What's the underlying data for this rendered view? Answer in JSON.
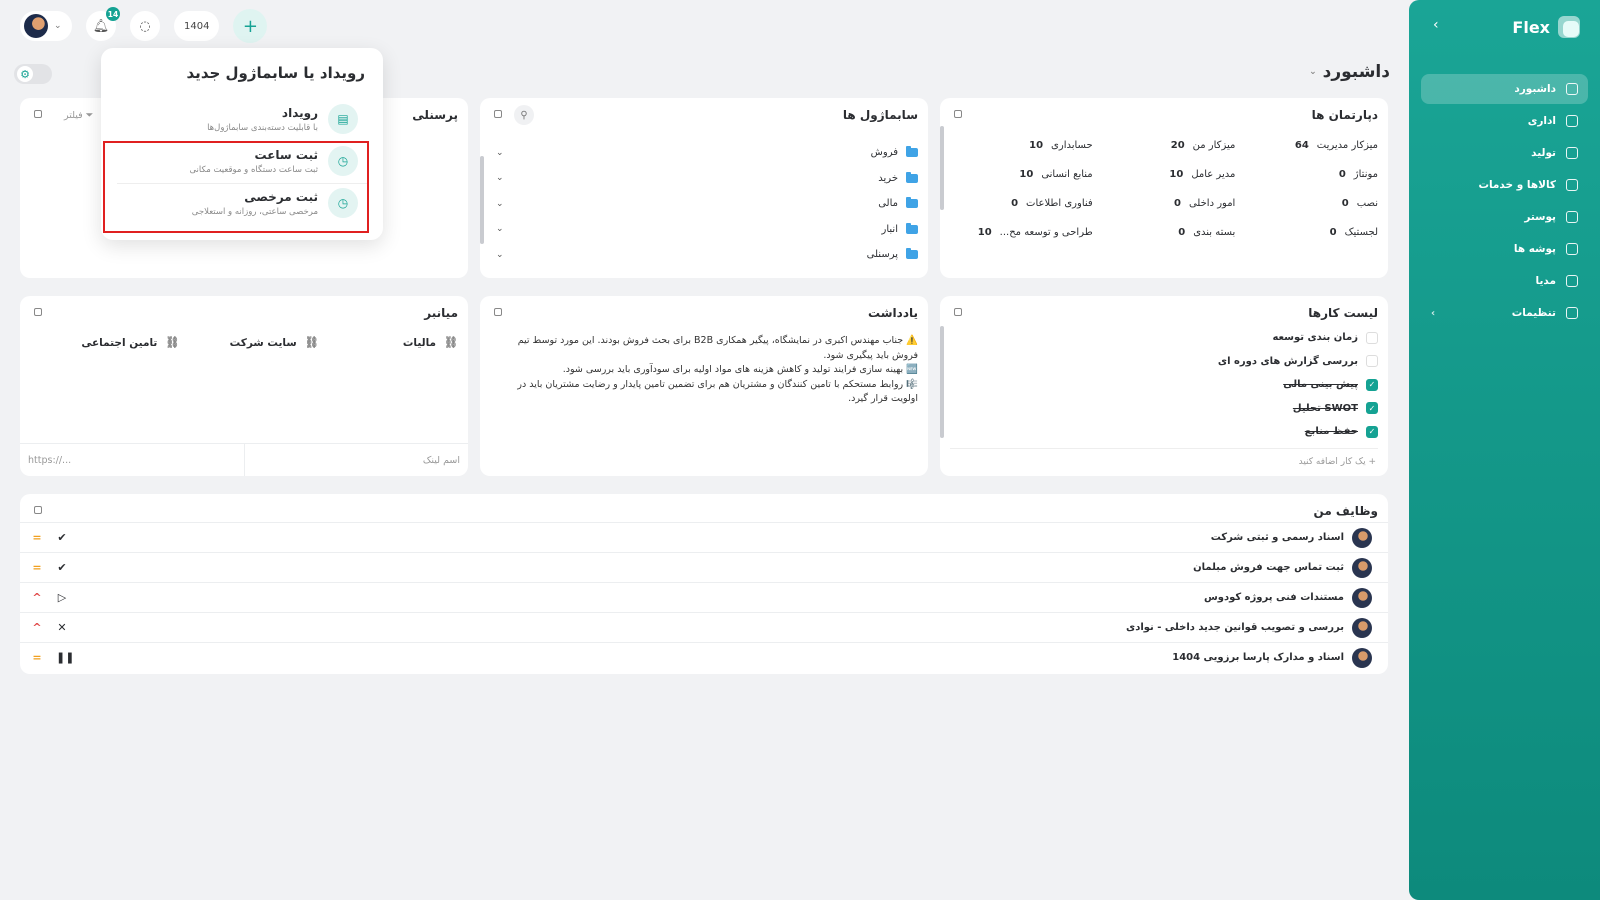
{
  "sidebar": {
    "brand": "Flex",
    "collapse_icon": "chevron-left-icon",
    "items": [
      {
        "label": "داشبورد",
        "icon": "home-icon",
        "active": true
      },
      {
        "label": "اداری",
        "icon": "briefcase-icon"
      },
      {
        "label": "تولید",
        "icon": "factory-icon"
      },
      {
        "label": "کالاها و خدمات",
        "icon": "box-icon"
      },
      {
        "label": "پوستر",
        "icon": "image-icon"
      },
      {
        "label": "پوشه ها",
        "icon": "folder-icon"
      },
      {
        "label": "مدیا",
        "icon": "media-icon"
      },
      {
        "label": "تنظیمات",
        "icon": "gear-icon",
        "has_submenu": true
      }
    ]
  },
  "topbar": {
    "notifications_count": "14",
    "year": "1404",
    "add_icon": "plus-icon"
  },
  "page_title": "داشبورد",
  "departments": {
    "title": "دپارتمان ها",
    "items": [
      {
        "num": "64",
        "name": "میزکار مدیریت"
      },
      {
        "num": "20",
        "name": "میزکار من"
      },
      {
        "num": "10",
        "name": "حسابداری"
      },
      {
        "num": "0",
        "name": "مونتاژ"
      },
      {
        "num": "10",
        "name": "مدیر عامل"
      },
      {
        "num": "10",
        "name": "منابع انسانی"
      },
      {
        "num": "0",
        "name": "نصب"
      },
      {
        "num": "0",
        "name": "امور داخلی"
      },
      {
        "num": "0",
        "name": "فناوری اطلاعات"
      },
      {
        "num": "0",
        "name": "لجستیک"
      },
      {
        "num": "0",
        "name": "بسته بندی"
      },
      {
        "num": "10",
        "name": "طراحی و توسعه مح..."
      }
    ]
  },
  "orgchart": {
    "title": "سابماژول ها",
    "items": [
      "فروش",
      "خرید",
      "مالی",
      "انبار",
      "پرسنلی"
    ]
  },
  "personnel": {
    "title": "پرسنلی",
    "filter_label": "فیلتر"
  },
  "popup": {
    "title": "رویداد یا سابماژول جدید",
    "options": [
      {
        "title": "رویداد",
        "subtitle": "با قابلیت دسته‌بندی سابماژول‌ها"
      },
      {
        "title": "ثبت ساعت",
        "subtitle": "ثبت ساعت دستگاه و موقعیت مکانی"
      },
      {
        "title": "ثبت مرخصی",
        "subtitle": "مرخصی ساعتی، روزانه و استعلاجی"
      }
    ]
  },
  "shortcuts": {
    "title": "میانبر",
    "links": [
      "مالیات",
      "سایت شرکت",
      "تامین اجتماعی"
    ],
    "name_placeholder": "اسم لینک",
    "url_placeholder": "https://..."
  },
  "notes": {
    "title": "یادداشت",
    "lines": [
      "⚠️ جناب مهندس اکبری در نمایشگاه، پیگیر همکاری B2B برای بحث فروش بودند. این مورد توسط تیم فروش باید پیگیری شود.",
      "🆕 بهینه سازی فرایند تولید و کاهش هزینه های مواد اولیه برای سودآوری باید بررسی شود.",
      "🎼 روابط مستحکم با تامین کنندگان و مشتریان هم برای تضمین  تامین پایدار و رضایت مشتریان باید در اولویت قرار گیرد."
    ]
  },
  "tasklist": {
    "title": "لیست کارها",
    "items": [
      {
        "label": "زمان بندی توسعه",
        "done": false
      },
      {
        "label": "بررسی گزارش های دوره ای",
        "done": false
      },
      {
        "label": "پیش بینی مالی",
        "done": true
      },
      {
        "label": "تحلیل SWOT",
        "done": true
      },
      {
        "label": "حفظ منابع",
        "done": true
      }
    ],
    "add_label": "یک کار اضافه کنید"
  },
  "mytasks": {
    "title": "وظایف من",
    "rows": [
      {
        "name": "اسناد رسمی و ثبتی شرکت",
        "priority": "=",
        "priority_color": "#f0a020",
        "status": "✔"
      },
      {
        "name": "ثبت تماس جهت فروش مبلمان",
        "priority": "=",
        "priority_color": "#f0a020",
        "status": "✔"
      },
      {
        "name": "مستندات فنی پروژه کودوس",
        "priority": "^",
        "priority_color": "#e04848",
        "status": "▷"
      },
      {
        "name": "بررسی و تصویب قوانین جدید داخلی - نوادی",
        "priority": "^",
        "priority_color": "#e04848",
        "status": "✕"
      },
      {
        "name": "اسناد و مدارک پارسا برزویی 1404",
        "priority": "=",
        "priority_color": "#f0a020",
        "status": "❚❚"
      }
    ]
  },
  "colors": {
    "accent": "#15a293",
    "highlight_box": "#e02020"
  }
}
